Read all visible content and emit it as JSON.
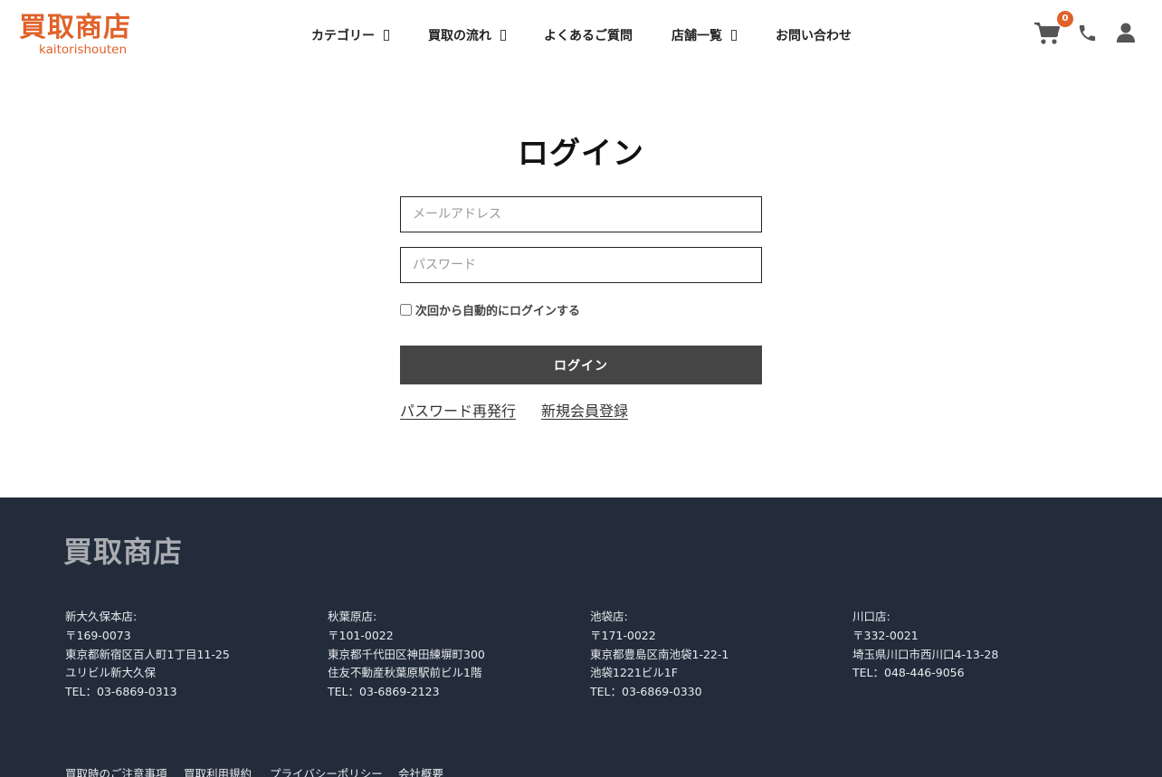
{
  "brand": {
    "logo_kanji": "買取商店",
    "logo_roman": "kaitorishouten",
    "accent_color": "#e0622a"
  },
  "nav": {
    "items": [
      {
        "label": "カテゴリー",
        "has_dropdown": true
      },
      {
        "label": "買取の流れ",
        "has_dropdown": true
      },
      {
        "label": "よくあるご質問",
        "has_dropdown": false
      },
      {
        "label": "店舗一覧",
        "has_dropdown": true
      },
      {
        "label": "お問い合わせ",
        "has_dropdown": false
      }
    ]
  },
  "header_icons": {
    "cart_icon": "shopping-cart",
    "cart_count": "0",
    "phone_icon": "phone",
    "user_icon": "user"
  },
  "login": {
    "title": "ログイン",
    "email_placeholder": "メールアドレス",
    "email_value": "",
    "password_placeholder": "パスワード",
    "password_value": "",
    "remember_label": "次回から自動的にログインする",
    "remember_checked": false,
    "submit_label": "ログイン",
    "reset_link": "パスワード再発行",
    "register_link": "新規会員登録"
  },
  "footer": {
    "logo": "買取商店",
    "stores": [
      {
        "name": "新大久保本店:",
        "postal": "〒169-0073",
        "address1": "東京都新宿区百人町1丁目11-25",
        "address2": "ユリビル新大久保",
        "tel": "TEL：03-6869-0313"
      },
      {
        "name": "秋葉原店:",
        "postal": "〒101-0022",
        "address1": "東京都千代田区神田練塀町300",
        "address2": "住友不動産秋葉原駅前ビル1階",
        "tel": "TEL：03-6869-2123"
      },
      {
        "name": "池袋店:",
        "postal": "〒171-0022",
        "address1": "東京都豊島区南池袋1-22-1",
        "address2": "池袋1221ビル1F",
        "tel": "TEL：03-6869-0330"
      },
      {
        "name": "川口店:",
        "postal": "〒332-0021",
        "address1": "埼玉県川口市西川口4-13-28",
        "address2": "",
        "tel": "TEL：048-446-9056"
      }
    ],
    "links": [
      "買取時のご注意事項",
      "買取利用規約",
      "プライバシーポリシー",
      "会社概要"
    ]
  }
}
